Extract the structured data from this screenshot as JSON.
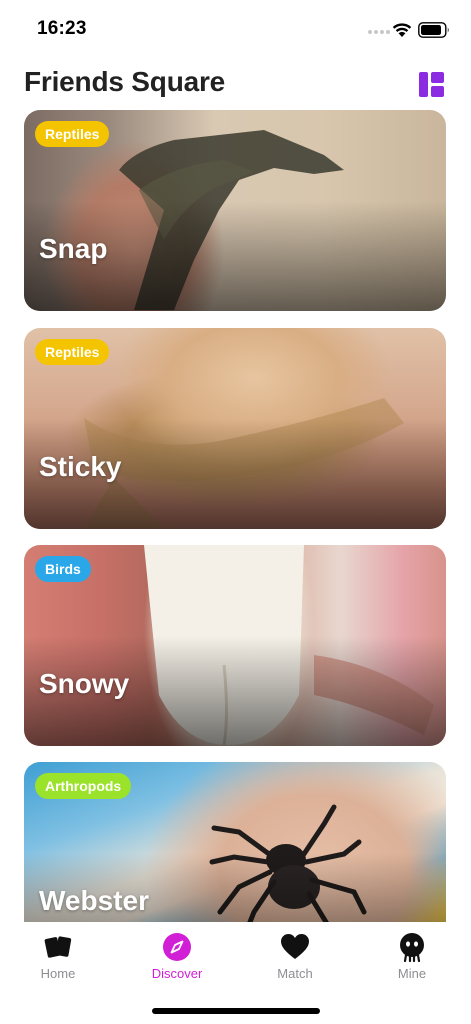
{
  "status_bar": {
    "time": "16:23"
  },
  "header": {
    "title": "Friends Square",
    "layout_icon": "layout-grid-icon",
    "accent_color": "#8b2be2"
  },
  "feed": {
    "cards": [
      {
        "name": "Snap",
        "category": "Reptiles",
        "category_color": "#f5c400"
      },
      {
        "name": "Sticky",
        "category": "Reptiles",
        "category_color": "#f5c400"
      },
      {
        "name": "Snowy",
        "category": "Birds",
        "category_color": "#2aa7e8"
      },
      {
        "name": "Webster",
        "category": "Arthropods",
        "category_color": "#9be22a"
      }
    ]
  },
  "tab_bar": {
    "tabs": [
      {
        "label": "Home",
        "icon": "cards-icon",
        "active": false
      },
      {
        "label": "Discover",
        "icon": "compass-icon",
        "active": true
      },
      {
        "label": "Match",
        "icon": "heart-icon",
        "active": false
      },
      {
        "label": "Mine",
        "icon": "profile-icon",
        "active": false
      }
    ],
    "active_color": "#d11fd6",
    "inactive_color": "#8e8e93"
  }
}
